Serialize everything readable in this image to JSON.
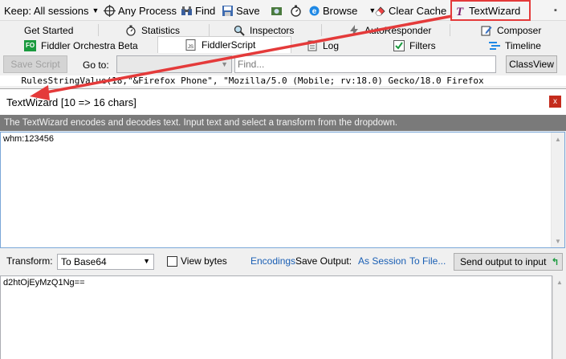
{
  "toolbar": {
    "keep": "Keep: All sessions",
    "any_process": "Any Process",
    "find": "Find",
    "save": "Save",
    "browse": "Browse",
    "clear_cache": "Clear Cache",
    "text_wizard": "TextWizard"
  },
  "tabs_row1": [
    "Get Started",
    "Statistics",
    "Inspectors",
    "AutoResponder",
    "Composer"
  ],
  "tabs_row2": {
    "orchestra": "Fiddler Orchestra Beta",
    "orchestra_badge": "FO",
    "script": "FiddlerScript",
    "log": "Log",
    "filters": "Filters",
    "timeline": "Timeline"
  },
  "scriptbar": {
    "save_script": "Save Script",
    "goto": "Go to:",
    "find_placeholder": "Find...",
    "classview": "ClassView"
  },
  "code_line": "    RulesStringValue(18,\"&Firefox Phone\", \"Mozilla/5.0 (Mobile; rv:18.0) Gecko/18.0 Firefox",
  "wizard": {
    "title": "TextWizard [10 => 16 chars]",
    "description": "The TextWizard encodes and decodes text. Input text and select a transform from the dropdown.",
    "input_text": "whm:123456",
    "transform_label": "Transform:",
    "transform_value": "To Base64",
    "view_bytes": "View bytes",
    "encodings": "Encodings",
    "save_output": "Save Output:",
    "as_session": "As Session",
    "to_file": "To File...",
    "send_output": "Send output to input",
    "output_text": "d2htOjEyMzQ1Ng=="
  },
  "colors": {
    "annotation": "#e43a3a",
    "link": "#1a5fb4",
    "description_bar": "#7a7a7a"
  }
}
